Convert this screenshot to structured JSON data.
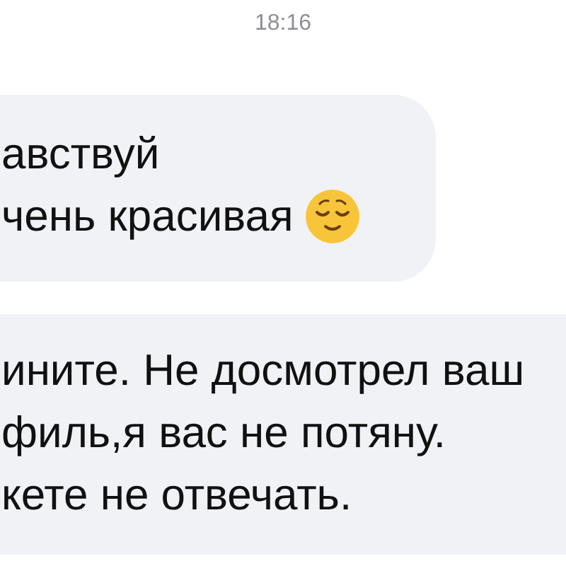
{
  "timestamp": "18:16",
  "messages": [
    {
      "lines": [
        "авствуй",
        "чень красивая"
      ],
      "emoji": true
    },
    {
      "lines": [
        "ините. Не досмотрел ваш",
        "филь,я вас не потяну.",
        "кете не отвечать."
      ],
      "emoji": false
    }
  ]
}
